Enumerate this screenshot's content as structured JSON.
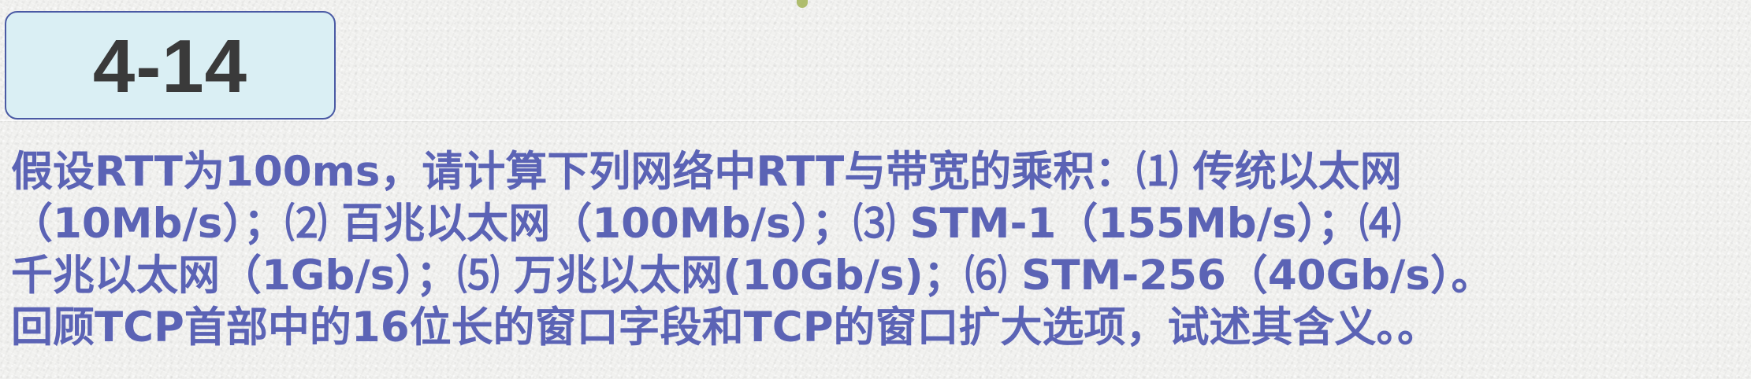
{
  "slide": {
    "title": "4-14",
    "question_lines": [
      "假设RTT为100ms，请计算下列网络中RTT与带宽的乘积：⑴ 传统以太网",
      "（10Mb/s）；⑵ 百兆以太网（100Mb/s）；⑶ STM-1（155Mb/s）；⑷",
      "千兆以太网（1Gb/s）；⑸ 万兆以太网(10Gb/s)；⑹ STM-256（40Gb/s）。",
      "回顾TCP首部中的16位长的窗口字段和TCP的窗口扩大选项，试述其含义。。"
    ]
  },
  "colors": {
    "question_text": "#5b63b5",
    "title_box_fill": "#daeff4",
    "title_box_border": "#4a5aa4",
    "title_text": "#3a3a3a"
  }
}
